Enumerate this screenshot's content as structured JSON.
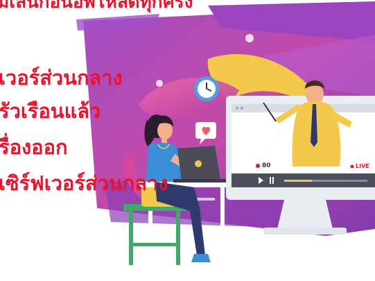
{
  "captions": {
    "top": "มเล่นก่อนอัพโหลดทุกครั้ง",
    "line1": "เวอร์ส่วนกลาง",
    "line2": "รัวเรือนแล้ว",
    "line3": "รื่องออก",
    "line4": "เซิร์ฟเวอร์ส่วนกลาง"
  },
  "video_player": {
    "viewer_count": "80",
    "live_label": "LIVE"
  },
  "colors": {
    "caption": "#e8142d",
    "purple": "#7b3fb0",
    "pink": "#d9479a",
    "yellow": "#f4c84a"
  }
}
